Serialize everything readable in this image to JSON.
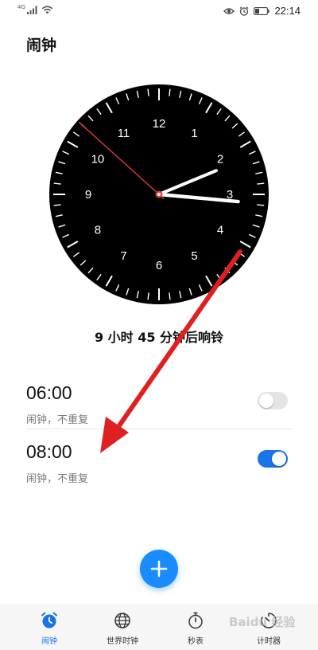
{
  "status_bar": {
    "network": "4G",
    "time": "22:14"
  },
  "header": {
    "title": "闹钟"
  },
  "clock": {
    "numbers": [
      "12",
      "1",
      "2",
      "3",
      "4",
      "5",
      "6",
      "7",
      "8",
      "9",
      "10",
      "11"
    ],
    "hour": 2,
    "minute": 15,
    "second": 52,
    "face_color": "#000000",
    "second_hand_color": "#e53935"
  },
  "countdown": {
    "text": "9 小时 45 分钟后响铃"
  },
  "alarms": [
    {
      "time": "06:00",
      "desc": "闹钟，不重复",
      "enabled": false
    },
    {
      "time": "08:00",
      "desc": "闹钟，不重复",
      "enabled": true
    }
  ],
  "fab": {
    "icon": "plus-icon",
    "color": "#1a8cff"
  },
  "tabbar": {
    "tabs": [
      {
        "label": "闹钟",
        "icon": "alarm-icon",
        "active": true
      },
      {
        "label": "世界时钟",
        "icon": "globe-icon",
        "active": false
      },
      {
        "label": "秒表",
        "icon": "stopwatch-icon",
        "active": false
      },
      {
        "label": "计时器",
        "icon": "timer-icon",
        "active": false
      }
    ],
    "accent": "#1a73e8"
  },
  "overlay": {
    "arrow_color": "#e02020",
    "watermark": "Baidu 经验"
  }
}
